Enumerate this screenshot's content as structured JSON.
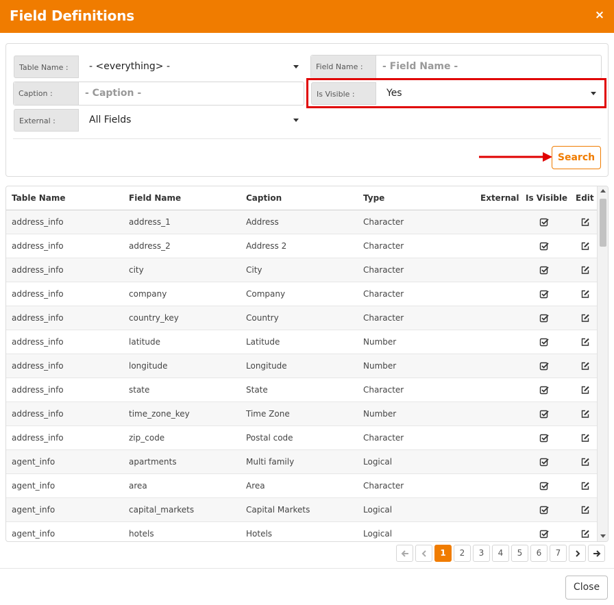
{
  "dialog": {
    "title": "Field Definitions",
    "close_symbol": "×"
  },
  "filters": {
    "table_name": {
      "label": "Table Name :",
      "value": "- <everything> -"
    },
    "field_name": {
      "label": "Field Name :",
      "placeholder": "- Field Name -"
    },
    "caption": {
      "label": "Caption :",
      "placeholder": "- Caption -"
    },
    "is_visible": {
      "label": "Is Visible :",
      "value": "Yes"
    },
    "external": {
      "label": "External :",
      "value": "All Fields"
    },
    "search_label": "Search"
  },
  "table": {
    "headers": [
      "Table Name",
      "Field Name",
      "Caption",
      "Type",
      "External",
      "Is Visible",
      "Edit"
    ],
    "rows": [
      [
        "address_info",
        "address_1",
        "Address",
        "Character"
      ],
      [
        "address_info",
        "address_2",
        "Address 2",
        "Character"
      ],
      [
        "address_info",
        "city",
        "City",
        "Character"
      ],
      [
        "address_info",
        "company",
        "Company",
        "Character"
      ],
      [
        "address_info",
        "country_key",
        "Country",
        "Character"
      ],
      [
        "address_info",
        "latitude",
        "Latitude",
        "Number"
      ],
      [
        "address_info",
        "longitude",
        "Longitude",
        "Number"
      ],
      [
        "address_info",
        "state",
        "State",
        "Character"
      ],
      [
        "address_info",
        "time_zone_key",
        "Time Zone",
        "Number"
      ],
      [
        "address_info",
        "zip_code",
        "Postal code",
        "Character"
      ],
      [
        "agent_info",
        "apartments",
        "Multi family",
        "Logical"
      ],
      [
        "agent_info",
        "area",
        "Area",
        "Character"
      ],
      [
        "agent_info",
        "capital_markets",
        "Capital Markets",
        "Logical"
      ],
      [
        "agent_info",
        "hotels",
        "Hotels",
        "Logical"
      ]
    ]
  },
  "pagination": {
    "pages": [
      "1",
      "2",
      "3",
      "4",
      "5",
      "6",
      "7"
    ],
    "current": "1"
  },
  "footer": {
    "close_label": "Close"
  },
  "colors": {
    "accent": "#f07c00",
    "highlight": "#e00000"
  }
}
